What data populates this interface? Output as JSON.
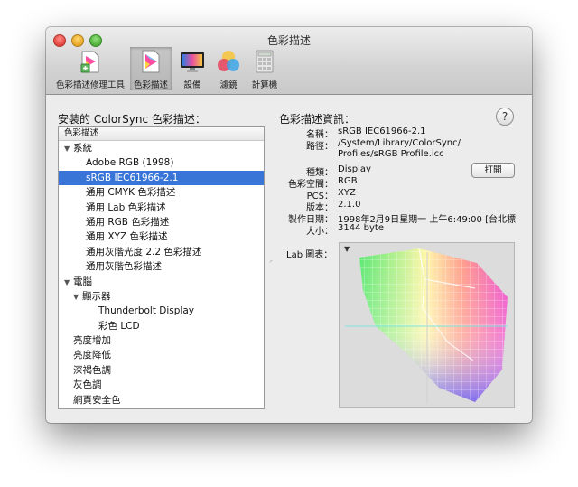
{
  "window": {
    "title": "色彩描述"
  },
  "toolbar": [
    {
      "label": "色彩描述修理工具",
      "icon": "colorsync-repair-icon"
    },
    {
      "label": "色彩描述",
      "icon": "profiles-icon"
    },
    {
      "label": "設備",
      "icon": "devices-icon"
    },
    {
      "label": "濾鏡",
      "icon": "filters-icon"
    },
    {
      "label": "計算機",
      "icon": "calculator-icon"
    }
  ],
  "left": {
    "heading": "安裝的 ColorSync 色彩描述：",
    "column_header": "色彩描述",
    "items": [
      {
        "label": "系統",
        "level": 0,
        "disclosure": "open"
      },
      {
        "label": "Adobe RGB (1998)",
        "level": 2
      },
      {
        "label": "sRGB IEC61966-2.1",
        "level": 2,
        "selected": true
      },
      {
        "label": "通用 CMYK 色彩描述",
        "level": 2
      },
      {
        "label": "通用 Lab 色彩描述",
        "level": 2
      },
      {
        "label": "通用 RGB 色彩描述",
        "level": 2
      },
      {
        "label": "通用 XYZ 色彩描述",
        "level": 2
      },
      {
        "label": "通用灰階光度 2.2 色彩描述",
        "level": 2
      },
      {
        "label": "通用灰階色彩描述",
        "level": 2
      },
      {
        "label": "電腦",
        "level": 0,
        "disclosure": "open"
      },
      {
        "label": "顯示器",
        "level": 1,
        "disclosure": "open"
      },
      {
        "label": "Thunderbolt Display",
        "level": 3
      },
      {
        "label": "彩色 LCD",
        "level": 3
      },
      {
        "label": "亮度增加",
        "level": 1
      },
      {
        "label": "亮度降低",
        "level": 1
      },
      {
        "label": "深褐色調",
        "level": 1
      },
      {
        "label": "灰色調",
        "level": 1
      },
      {
        "label": "網頁安全色",
        "level": 1
      }
    ]
  },
  "right": {
    "heading": "色彩描述資訊：",
    "help": "?",
    "open_button": "打開",
    "lab_label": "Lab 圖表：",
    "fields": [
      {
        "key": "名稱：",
        "value": "sRGB IEC61966-2.1"
      },
      {
        "key": "路徑：",
        "value": "/System/Library/ColorSync/",
        "value2": "Profiles/sRGB Profile.icc"
      },
      {
        "key": "種類：",
        "value": "Display"
      },
      {
        "key": "色彩空間：",
        "value": "RGB"
      },
      {
        "key": "PCS：",
        "value": "XYZ"
      },
      {
        "key": "版本：",
        "value": "2.1.0"
      },
      {
        "key": "製作日期：",
        "value": "1998年2月9日星期一 上午6:49:00 [台北標"
      },
      {
        "key": "大小：",
        "value": "3144 byte"
      }
    ]
  },
  "colors": {
    "selection": "#3875d7",
    "window_bg": "#ececec"
  }
}
